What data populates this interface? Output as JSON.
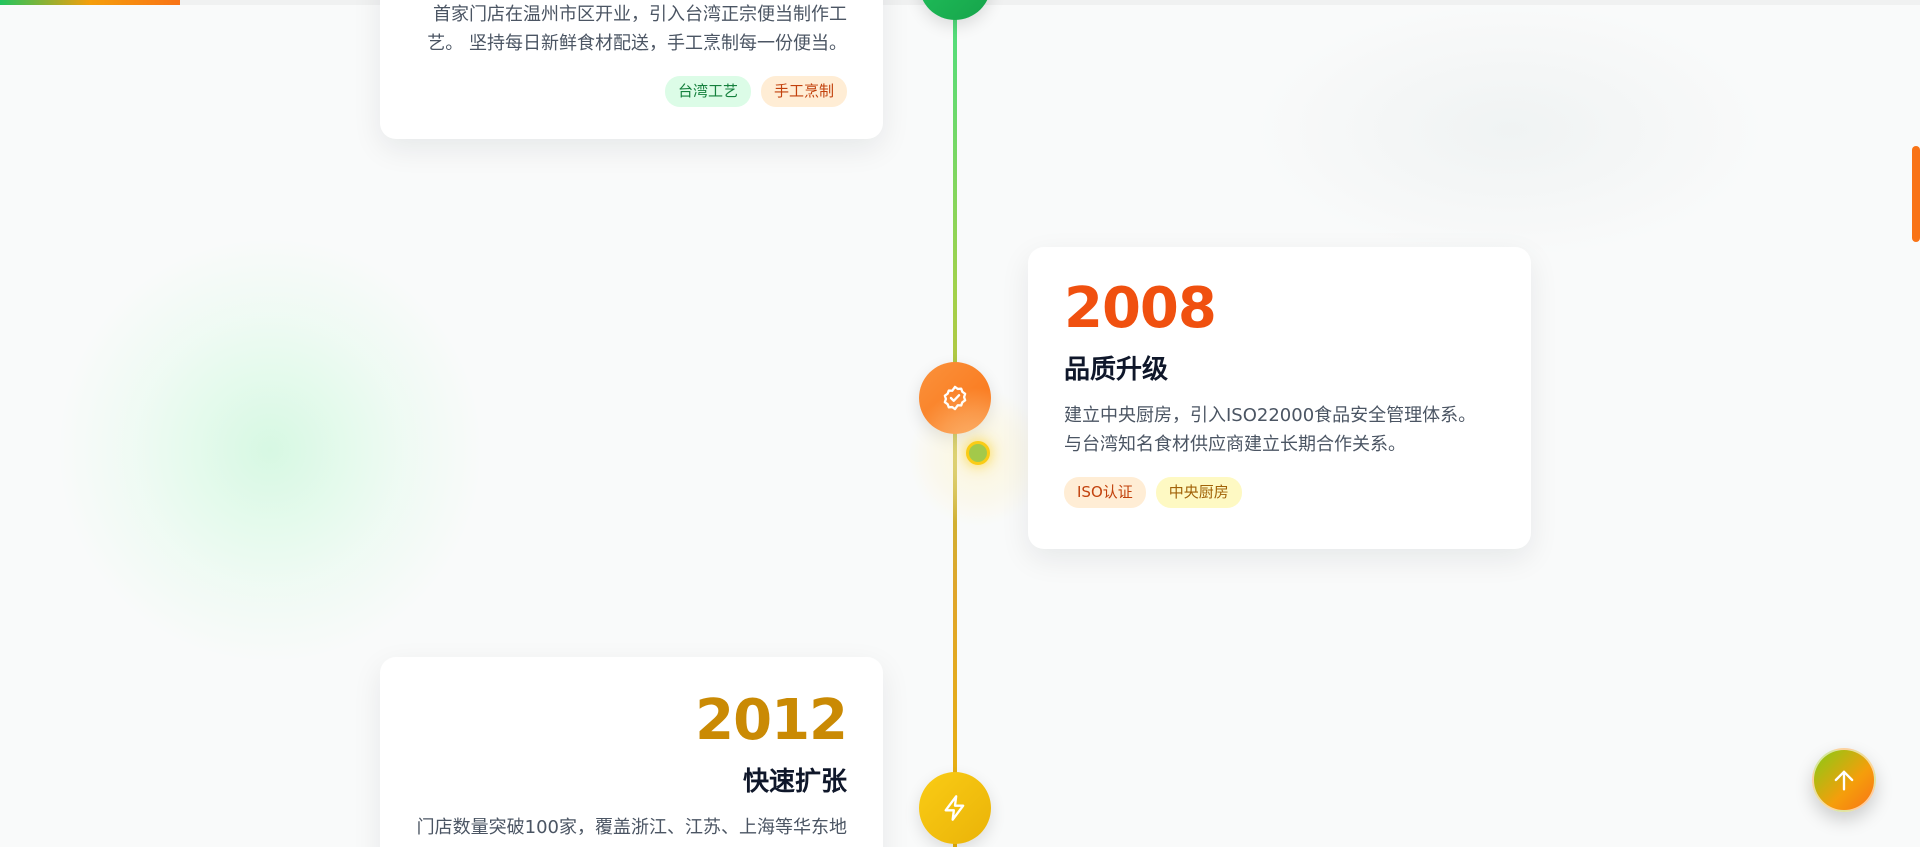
{
  "timeline": {
    "items": [
      {
        "desc": "首家门店在温州市区开业，引入台湾正宗便当制作工艺。 坚持每日新鲜食材配送，手工烹制每一份便当。",
        "tags": [
          "台湾工艺",
          "手工烹制"
        ],
        "icon": "leaf-icon",
        "color": "#22c55e"
      },
      {
        "year": "2008",
        "title": "品质升级",
        "desc": "建立中央厨房，引入ISO22000食品安全管理体系。 与台湾知名食材供应商建立长期合作关系。",
        "tags": [
          "ISO认证",
          "中央厨房"
        ],
        "icon": "badge-check-icon",
        "color": "#f97316"
      },
      {
        "year": "2012",
        "title": "快速扩张",
        "desc": "门店数量突破100家，覆盖浙江、江苏、上海等华东地",
        "icon": "lightning-icon",
        "color": "#eab308"
      }
    ]
  },
  "scroll_progress": 0.094,
  "colors": {
    "accent_green": "#22c55e",
    "accent_orange": "#f97316",
    "accent_gold": "#eab308",
    "year_orange": "#f0500f",
    "year_gold": "#ca8a04"
  },
  "back_to_top": {
    "icon": "arrow-up-icon"
  }
}
